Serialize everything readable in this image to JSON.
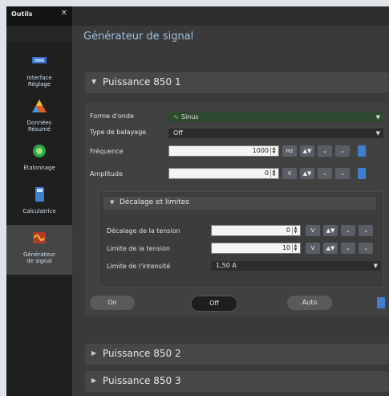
{
  "sidebar": {
    "title": "Outils",
    "close": "✕",
    "items": [
      {
        "label": "Interface\nRéglage",
        "icon": "interface-icon"
      },
      {
        "label": "Données\nRésumé",
        "icon": "data-summary-icon"
      },
      {
        "label": "Étalonnage",
        "icon": "calibration-icon"
      },
      {
        "label": "Calculatrice",
        "icon": "calculator-icon"
      },
      {
        "label": "Générateur\nde signal",
        "icon": "signal-generator-icon",
        "active": true
      }
    ]
  },
  "main": {
    "title": "Générateur de signal",
    "panels": [
      {
        "title": "Puissance 850 1",
        "expanded": true
      },
      {
        "title": "Puissance 850 2",
        "expanded": false
      },
      {
        "title": "Puissance 850 3",
        "expanded": false
      }
    ]
  },
  "form": {
    "waveform_label": "Forme d'onde",
    "waveform_value": "Sinus",
    "sweep_label": "Type de balayage",
    "sweep_value": "Off",
    "frequency_label": "Fréquence",
    "frequency_value": "1000",
    "amplitude_label": "Amplitude",
    "amplitude_value": "0"
  },
  "limits": {
    "title": "Décalage et limites",
    "offset_label": "Décalage de la tension",
    "offset_value": "0",
    "voltage_limit_label": "Limite de la tension",
    "voltage_limit_value": "10",
    "current_limit_label": "Limite de l'intensité",
    "current_limit_value": "1,50 A"
  },
  "units": {
    "hz": "Hz",
    "v": "V"
  },
  "buttons": {
    "on": "On",
    "off": "Off",
    "auto": "Auto"
  }
}
